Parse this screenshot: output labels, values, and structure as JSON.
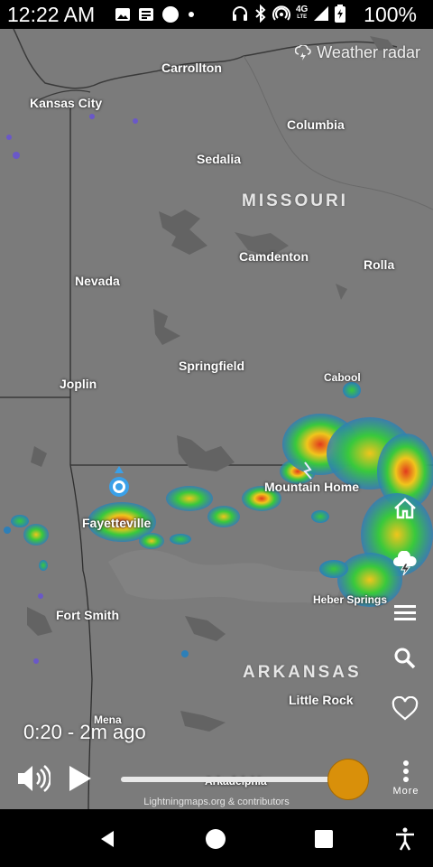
{
  "status_bar": {
    "time": "12:22 AM",
    "battery": "100%",
    "left_icons": [
      "image-icon",
      "news-icon",
      "circle-notification-icon",
      "dot-icon"
    ],
    "right_icons": [
      "headphones-icon",
      "bluetooth-icon",
      "hotspot-icon",
      "4g-lte-icon",
      "signal-icon",
      "battery-icon"
    ],
    "network": "4G"
  },
  "map": {
    "header_label": "Weather radar",
    "states": [
      "MISSOURI",
      "ARKANSAS"
    ],
    "cities": {
      "carrollton": "Carrollton",
      "kansas_city": "Kansas City",
      "columbia": "Columbia",
      "sedalia": "Sedalia",
      "camdenton": "Camdenton",
      "rolla": "Rolla",
      "nevada": "Nevada",
      "springfield": "Springfield",
      "cabool": "Cabool",
      "joplin": "Joplin",
      "mountain_home": "Mountain Home",
      "fayetteville": "Fayetteville",
      "heber_springs": "Heber Springs",
      "fort_smith": "Fort Smith",
      "little_rock": "Little Rock",
      "mena": "Mena",
      "arkadelphia": "Arkadelphia"
    },
    "attribution": "Lightningmaps.org & contributors"
  },
  "side_buttons": [
    "home-icon",
    "lightning-cloud-icon",
    "menu-icon",
    "search-icon",
    "heart-icon"
  ],
  "playback": {
    "timestamp": "0:20 - 2m ago",
    "more_label": "More",
    "accent_color": "#d9900a"
  },
  "nav_bar": [
    "back-icon",
    "home-circle-icon",
    "recents-icon",
    "accessibility-icon"
  ]
}
